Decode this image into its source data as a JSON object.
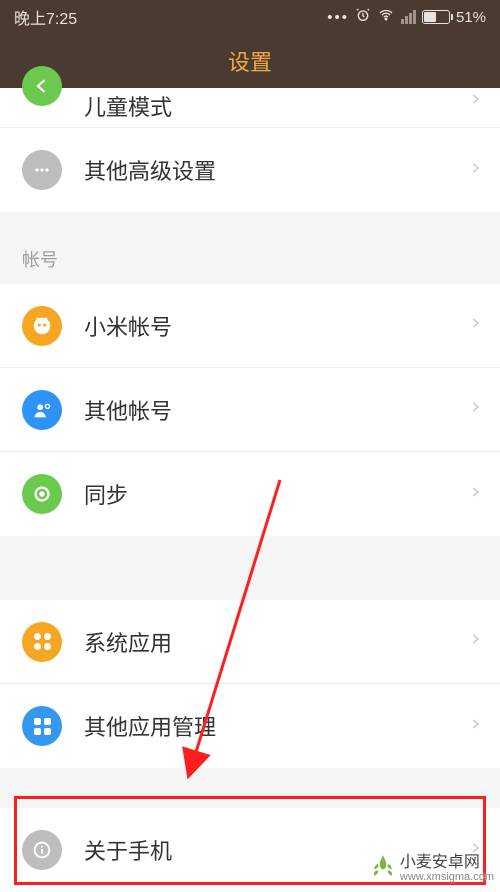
{
  "status": {
    "time": "晚上7:25",
    "battery_pct": "51%"
  },
  "header": {
    "title": "设置"
  },
  "rows": {
    "kidmode": "儿童模式",
    "advanced": "其他高级设置",
    "xiaomi_account": "小米帐号",
    "other_account": "其他帐号",
    "sync": "同步",
    "system_apps": "系统应用",
    "other_app_mgmt": "其他应用管理",
    "about_phone": "关于手机"
  },
  "sections": {
    "account": "帐号"
  },
  "watermark": {
    "name": "小麦安卓网",
    "url": "www.xmsigma.com"
  }
}
